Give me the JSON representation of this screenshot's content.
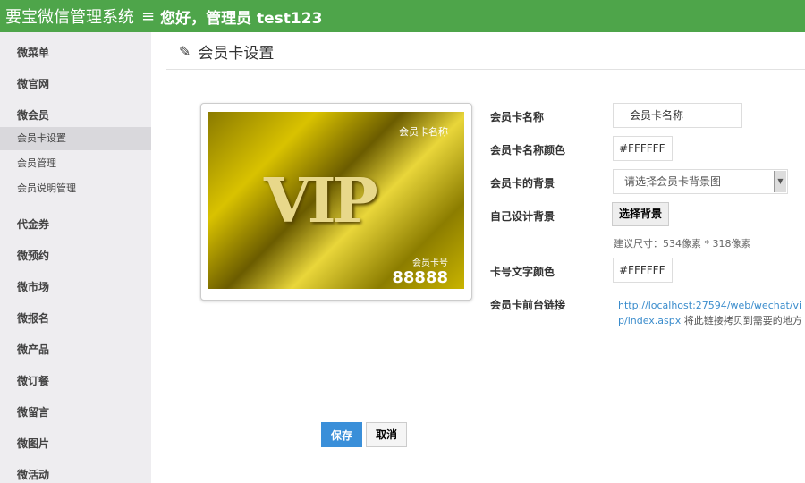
{
  "header": {
    "system_name": "要宝微信管理系统",
    "menu_icon": "≡",
    "greeting": "您好，管理员 test123"
  },
  "sidebar": {
    "items": [
      "微菜单",
      "微官网",
      "微会员"
    ],
    "sub_items": [
      "会员卡设置",
      "会员管理",
      "会员说明管理"
    ],
    "items2": [
      "代金券",
      "微预约",
      "微市场",
      "微报名",
      "微产品",
      "微订餐",
      "微留言",
      "微图片",
      "微活动"
    ]
  },
  "page": {
    "title": "会员卡设置"
  },
  "card": {
    "name": "会员卡名称",
    "vip": "VIP",
    "number_label": "会员卡号",
    "number": "88888"
  },
  "form": {
    "name_label": "会员卡名称",
    "name_value": "会员卡名称",
    "name_color_label": "会员卡名称颜色",
    "name_color_value": "#FFFFFF",
    "bg_label": "会员卡的背景",
    "bg_select": "请选择会员卡背景图",
    "design_label": "自己设计背景",
    "design_button": "选择背景",
    "size_hint": "建议尺寸：534像素 * 318像素",
    "number_color_label": "卡号文字颜色",
    "number_color_value": "#FFFFFF",
    "link_label": "会员卡前台链接",
    "link_url": "http://localhost:27594/web/wechat/vip/index.aspx",
    "link_note": " 将此链接拷贝到需要的地方"
  },
  "actions": {
    "save": "保存",
    "cancel": "取消"
  }
}
